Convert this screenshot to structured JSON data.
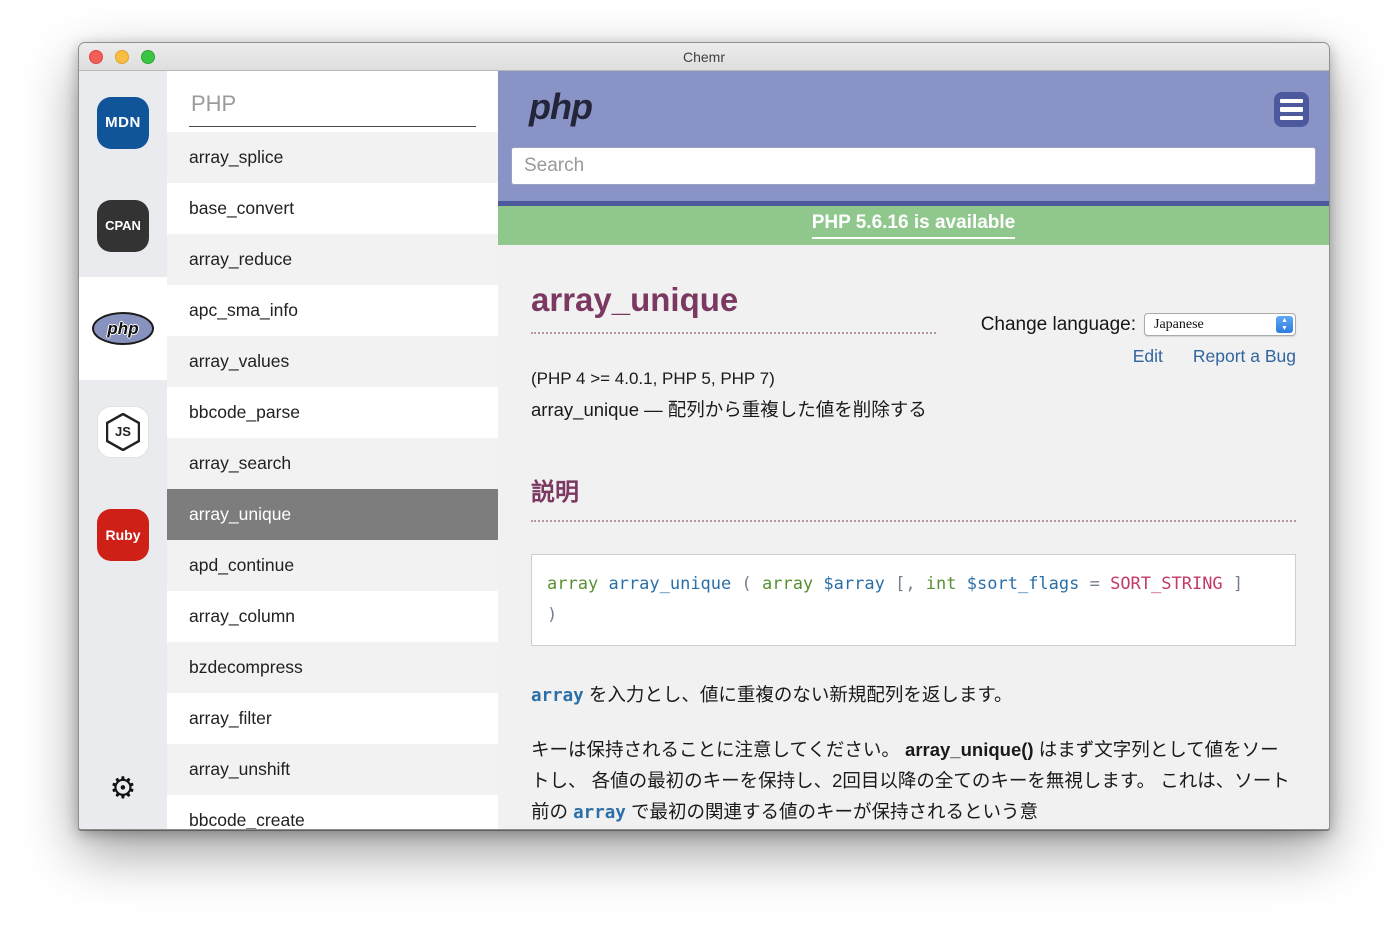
{
  "window": {
    "title": "Chemr"
  },
  "sidebar": {
    "items": [
      {
        "id": "mdn",
        "label": "MDN",
        "selected": false
      },
      {
        "id": "cpan",
        "label": "CPAN",
        "selected": false
      },
      {
        "id": "php",
        "label": "php",
        "selected": true
      },
      {
        "id": "nodejs",
        "label": "JS",
        "selected": false
      },
      {
        "id": "ruby",
        "label": "Ruby",
        "selected": false
      }
    ],
    "settings_icon": "gear-icon",
    "settings_glyph": "⚙"
  },
  "index": {
    "filter_value": "PHP",
    "selected_item": "array_unique",
    "items": [
      "array_splice",
      "base_convert",
      "array_reduce",
      "apc_sma_info",
      "array_values",
      "bbcode_parse",
      "array_search",
      "array_unique",
      "apd_continue",
      "array_column",
      "bzdecompress",
      "array_filter",
      "array_unshift",
      "bbcode_create"
    ]
  },
  "doc": {
    "site_logo": "php",
    "search_placeholder": "Search",
    "banner_text": "PHP 5.6.16 is available",
    "page_title": "array_unique",
    "language_label": "Change language:",
    "language_value": "Japanese",
    "edit_link": "Edit",
    "report_link": "Report a Bug",
    "version_line": "(PHP 4 >= 4.0.1, PHP 5, PHP 7)",
    "summary": "array_unique — 配列から重複した値を削除する",
    "section_heading": "説明",
    "code_lines": [
      [
        {
          "text": "array",
          "cls": "type"
        },
        {
          "text": " ",
          "cls": "plain"
        },
        {
          "text": "array_unique",
          "cls": "func"
        },
        {
          "text": " ( ",
          "cls": "plain"
        },
        {
          "text": "array",
          "cls": "type"
        },
        {
          "text": " ",
          "cls": "plain"
        },
        {
          "text": "$array",
          "cls": "var"
        },
        {
          "text": " [, ",
          "cls": "plain"
        },
        {
          "text": "int",
          "cls": "type"
        },
        {
          "text": " ",
          "cls": "plain"
        },
        {
          "text": "$sort_flags",
          "cls": "var"
        },
        {
          "text": " = ",
          "cls": "plain"
        },
        {
          "text": "SORT_STRING",
          "cls": "const"
        },
        {
          "text": " ]",
          "cls": "plain"
        }
      ],
      [
        {
          "text": ")",
          "cls": "plain"
        }
      ]
    ],
    "paragraphs": [
      [
        {
          "text": "array",
          "cls": "inline-code"
        },
        {
          "text": " を入力とし、値に重複のない新規配列を返します。",
          "cls": ""
        }
      ],
      [
        {
          "text": "キーは保持されることに注意してください。 ",
          "cls": ""
        },
        {
          "text": "array_unique()",
          "cls": "strong"
        },
        {
          "text": " はまず文字列として値をソートし、 各値の最初のキーを保持し、2回目以降の全てのキーを無視します。 これは、ソート前の ",
          "cls": ""
        },
        {
          "text": "array",
          "cls": "inline-code"
        },
        {
          "text": " で最初の関連する値のキーが保持されるという意",
          "cls": ""
        }
      ]
    ]
  },
  "colors": {
    "header_purple": "#8a93c6",
    "navy": "#4c5a9d",
    "banner_green": "#90c78d",
    "heading_purple": "#7b3962",
    "link_blue": "#31659f",
    "selected_row_gray": "#7d7d7d",
    "code_type_green": "#579032",
    "code_name_blue": "#2a6fa8",
    "code_const_red": "#c13a6a"
  }
}
